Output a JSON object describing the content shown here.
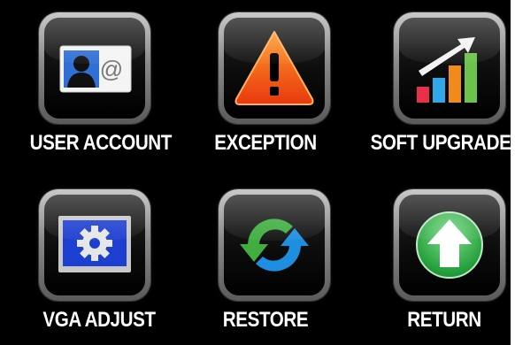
{
  "menu": {
    "items": [
      {
        "label": "USER ACCOUNT",
        "icon": "user-account-icon"
      },
      {
        "label": "EXCEPTION",
        "icon": "warning-icon"
      },
      {
        "label": "SOFT UPGRADE",
        "icon": "upgrade-chart-icon"
      },
      {
        "label": "VGA ADJUST",
        "icon": "gear-monitor-icon"
      },
      {
        "label": "RESTORE",
        "icon": "restore-arrows-icon"
      },
      {
        "label": "RETURN",
        "icon": "return-arrow-icon"
      }
    ]
  },
  "colors": {
    "background": "#000000",
    "label": "#ffffff",
    "warning": "#f04a14",
    "return_green": "#2fb84a",
    "restore_green": "#3fae3f",
    "restore_blue": "#1e8fe0"
  }
}
